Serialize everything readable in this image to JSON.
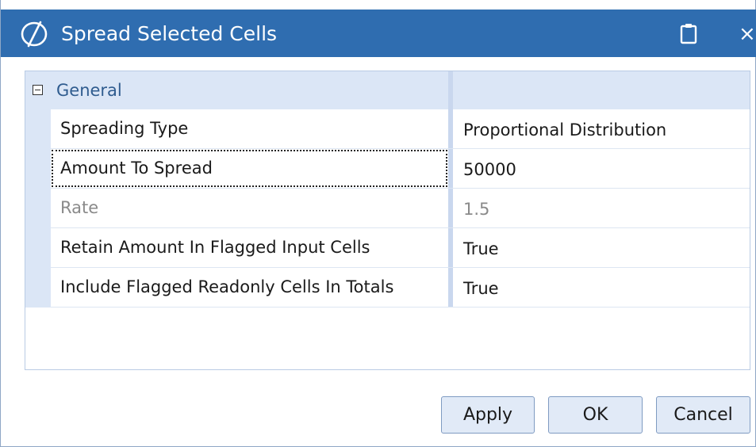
{
  "window": {
    "title": "Spread Selected Cells",
    "logo_icon": "onestream-logo-icon",
    "clipboard_icon": "clipboard-icon",
    "close_symbol": "×",
    "titlebar_color": "#2f6db0"
  },
  "property_grid": {
    "category": {
      "label": "General",
      "expanded": true,
      "expander_icon": "collapse-minus-icon"
    },
    "rows": [
      {
        "name": "Spreading Type",
        "value": "Proportional Distribution",
        "enabled": true
      },
      {
        "name": "Amount To Spread",
        "value": "50000",
        "enabled": true,
        "focused": true
      },
      {
        "name": "Rate",
        "value": "1.5",
        "enabled": false
      },
      {
        "name": "Retain Amount In Flagged Input Cells",
        "value": "True",
        "enabled": true
      },
      {
        "name": "Include Flagged Readonly Cells In Totals",
        "value": "True",
        "enabled": true
      }
    ]
  },
  "buttons": {
    "apply": "Apply",
    "ok": "OK",
    "cancel": "Cancel"
  }
}
